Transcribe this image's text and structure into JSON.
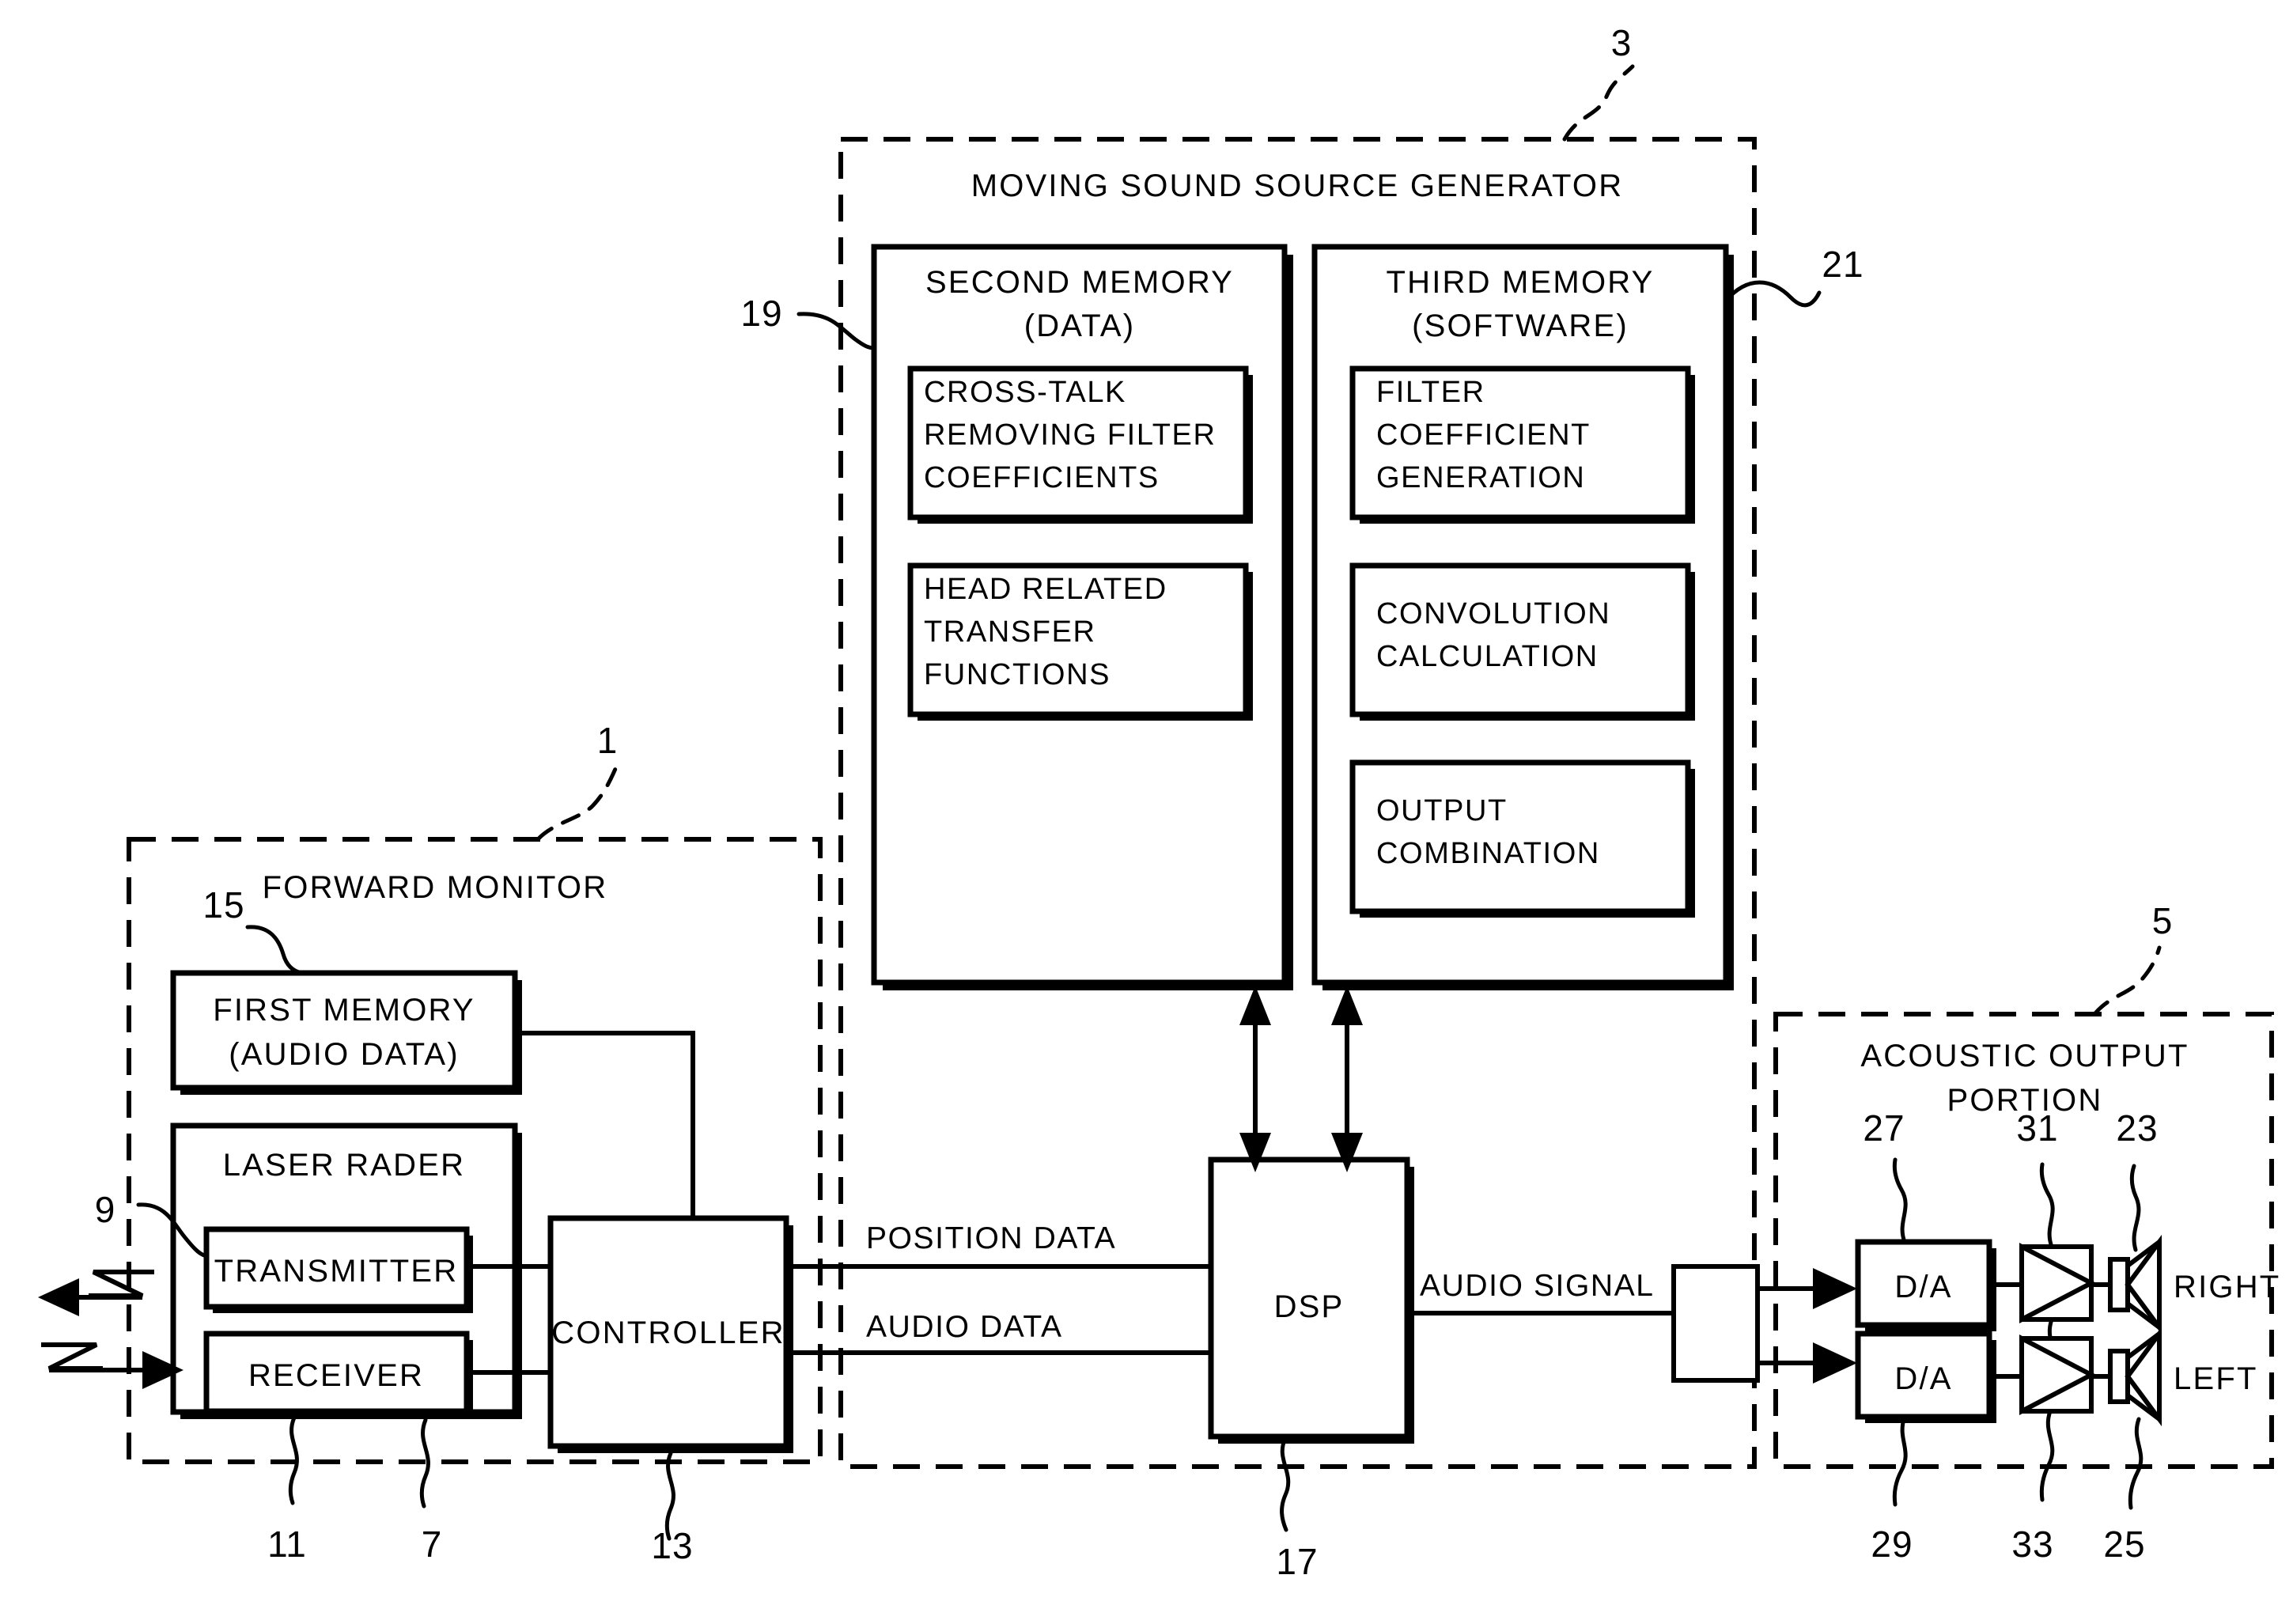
{
  "figure": {
    "type": "patent-block-diagram",
    "background": "#ffffff",
    "ink": "#000000"
  },
  "forward_monitor": {
    "title": "FORWARD MONITOR",
    "ref": "1",
    "first_memory": {
      "line1": "FIRST MEMORY",
      "line2": "(AUDIO DATA)",
      "ref": "15"
    },
    "laser_radar": {
      "title": "LASER RADER",
      "ref": "7",
      "transmitter": {
        "label": "TRANSMITTER",
        "ref": "9"
      },
      "receiver": {
        "label": "RECEIVER",
        "ref": "11"
      }
    },
    "controller": {
      "label": "CONTROLLER",
      "ref": "13"
    }
  },
  "moving_sound_source_generator": {
    "title": "MOVING SOUND SOURCE GENERATOR",
    "ref": "3",
    "second_memory": {
      "line1": "SECOND MEMORY",
      "line2": "(DATA)",
      "ref": "19",
      "items": [
        {
          "lines": [
            "CROSS-TALK",
            "REMOVING FILTER",
            "COEFFICIENTS"
          ]
        },
        {
          "lines": [
            "HEAD RELATED",
            "TRANSFER",
            "FUNCTIONS"
          ]
        }
      ]
    },
    "third_memory": {
      "line1": "THIRD MEMORY",
      "line2": "(SOFTWARE)",
      "ref": "21",
      "items": [
        {
          "lines": [
            "FILTER",
            "COEFFICIENT",
            "GENERATION"
          ]
        },
        {
          "lines": [
            "CONVOLUTION",
            "CALCULATION"
          ]
        },
        {
          "lines": [
            "OUTPUT",
            "COMBINATION"
          ]
        }
      ]
    },
    "dsp": {
      "label": "DSP",
      "ref": "17"
    }
  },
  "acoustic_output_portion": {
    "line1": "ACOUSTIC OUTPUT",
    "line2": "PORTION",
    "ref": "5",
    "channels": [
      {
        "converter_label": "D/A",
        "converter_ref": "27",
        "amplifier_ref": "31",
        "speaker_ref": "23",
        "speaker_label": "RIGHT"
      },
      {
        "converter_label": "D/A",
        "converter_ref": "29",
        "amplifier_ref": "33",
        "speaker_ref": "25",
        "speaker_label": "LEFT"
      }
    ]
  },
  "signal_labels": {
    "position_data": "POSITION DATA",
    "audio_data": "AUDIO DATA",
    "audio_signal": "AUDIO SIGNAL"
  }
}
